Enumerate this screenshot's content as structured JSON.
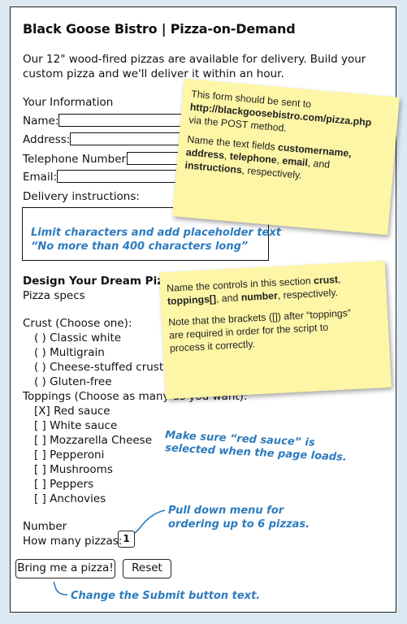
{
  "title": "Black Goose Bistro | Pizza-on-Demand",
  "intro": [
    "Our 12\" wood-fired pizzas are available for delivery. Build your",
    "custom pizza and we'll deliver it within an hour."
  ],
  "info": {
    "heading": "Your Information",
    "name_label": "Name:",
    "address_label": "Address:",
    "phone_label": "Telephone Number:",
    "email_label": "Email:",
    "delivery_label": "Delivery instructions:"
  },
  "note_textarea": [
    "Limit characters and add placeholder text",
    "“No more than 400 characters long”"
  ],
  "sticky1": {
    "line1": "This form should be sent to",
    "url": "http://blackgoosebistro.com/pizza.php",
    "line3": "via the POST method.",
    "p2_a": "Name the text fields",
    "p2_b": "customername,",
    "p2_c": "address",
    "p2_d": ", ",
    "p2_e": "telephone",
    "p2_f": ", ",
    "p2_g": "email",
    "p2_h": ", and",
    "p2_i": "instructions",
    "p2_j": ", respectively."
  },
  "design": {
    "heading": "Design Your Dream Pizza:",
    "specs": "Pizza specs",
    "crust_label": "Crust (Choose one):",
    "crusts": [
      "( ) Classic white",
      "( ) Multigrain",
      "( ) Cheese-stuffed crust",
      "( ) Gluten-free"
    ],
    "toppings_label": "Toppings (Choose as many as you want):",
    "toppings": [
      "[X] Red sauce",
      "[  ] White sauce",
      "[  ] Mozzarella Cheese",
      "[  ] Pepperoni",
      "[  ] Mushrooms",
      "[  ] Peppers",
      "[  ] Anchovies"
    ],
    "number_label": "Number",
    "how_many_label": "How many pizzas:",
    "how_many_value": "1"
  },
  "sticky2": {
    "a": "Name the controls in this section",
    "b": "crust",
    "c": ",",
    "d": "toppings[]",
    "e": ", and",
    "f": "number",
    "g": ", respectively.",
    "p2": [
      "Note that the brackets ([]) after “toppings”",
      "are required in order for the script to",
      "process it correctly."
    ]
  },
  "note_red": [
    "Make sure “red sauce” is",
    "selected when the page loads."
  ],
  "note_menu": [
    "Pull down menu for",
    "ordering up to 6 pizzas."
  ],
  "buttons": {
    "submit": "Bring me a pizza!",
    "reset": "Reset"
  },
  "note_submit": "Change the Submit button text.",
  "colors": {
    "background": "#dce9f2",
    "sticky": "#fdf6a6",
    "note": "#2d7bbf"
  }
}
